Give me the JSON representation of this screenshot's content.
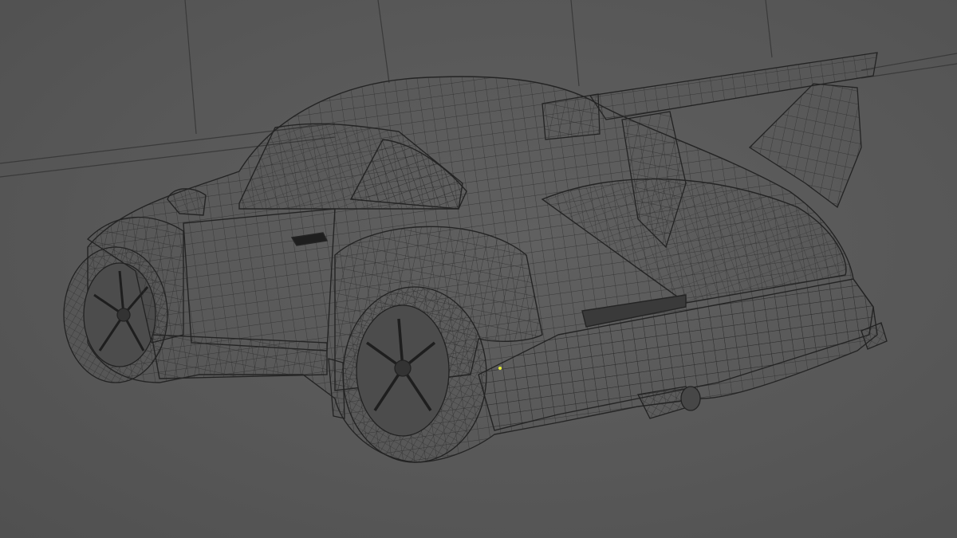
{
  "viewport": {
    "mode": "wireframe",
    "background": "#5a5a5a",
    "wire_color": "#2a2a2a",
    "selected_vertex_color": "#e8f03a"
  },
  "scene": {
    "object": "sports-car-wireframe",
    "view": "rear-three-quarter"
  }
}
